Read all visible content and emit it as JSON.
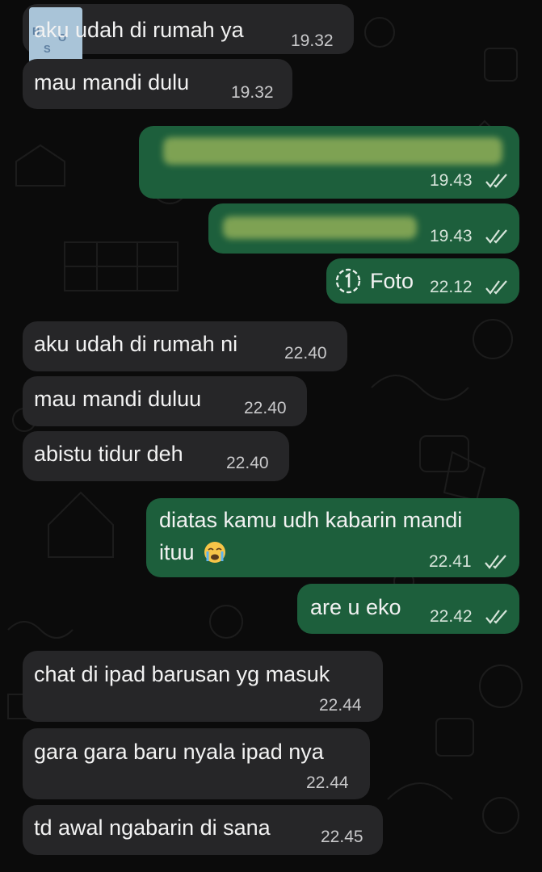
{
  "chat": {
    "messages": [
      {
        "from": "other",
        "text": "aku udah di rumah ya",
        "time": "19.32"
      },
      {
        "from": "other",
        "text": "mau mandi dulu",
        "time": "19.32"
      },
      {
        "from": "me",
        "text": "",
        "blurred": true,
        "time": "19.43",
        "status": "read"
      },
      {
        "from": "me",
        "text": "",
        "blurred": true,
        "time": "19.43",
        "status": "read"
      },
      {
        "from": "me",
        "text": "Foto",
        "icon": "view-once-icon",
        "time": "22.12",
        "status": "read"
      },
      {
        "from": "other",
        "text": "aku udah di rumah ni",
        "time": "22.40"
      },
      {
        "from": "other",
        "text": "mau mandi duluu",
        "time": "22.40"
      },
      {
        "from": "other",
        "text": "abistu tidur deh",
        "time": "22.40"
      },
      {
        "from": "me",
        "text_line1": "diatas kamu udh kabarin mandi",
        "text_line2": "ituu",
        "emoji": "loudly-crying-face",
        "time": "22.41",
        "status": "read"
      },
      {
        "from": "me",
        "text": "are u eko",
        "time": "22.42",
        "status": "read"
      },
      {
        "from": "other",
        "text": "chat di ipad barusan yg masuk",
        "time": "22.44"
      },
      {
        "from": "other",
        "text": "gara gara baru nyala ipad nya",
        "time": "22.44"
      },
      {
        "from": "other",
        "text": "td awal ngabarin di sana",
        "time": "22.45"
      }
    ]
  },
  "colors": {
    "background": "#0b0b0b",
    "incoming_bubble": "#262628",
    "outgoing_bubble": "#1d5f3c",
    "read_ticks": "#d6e4da"
  }
}
